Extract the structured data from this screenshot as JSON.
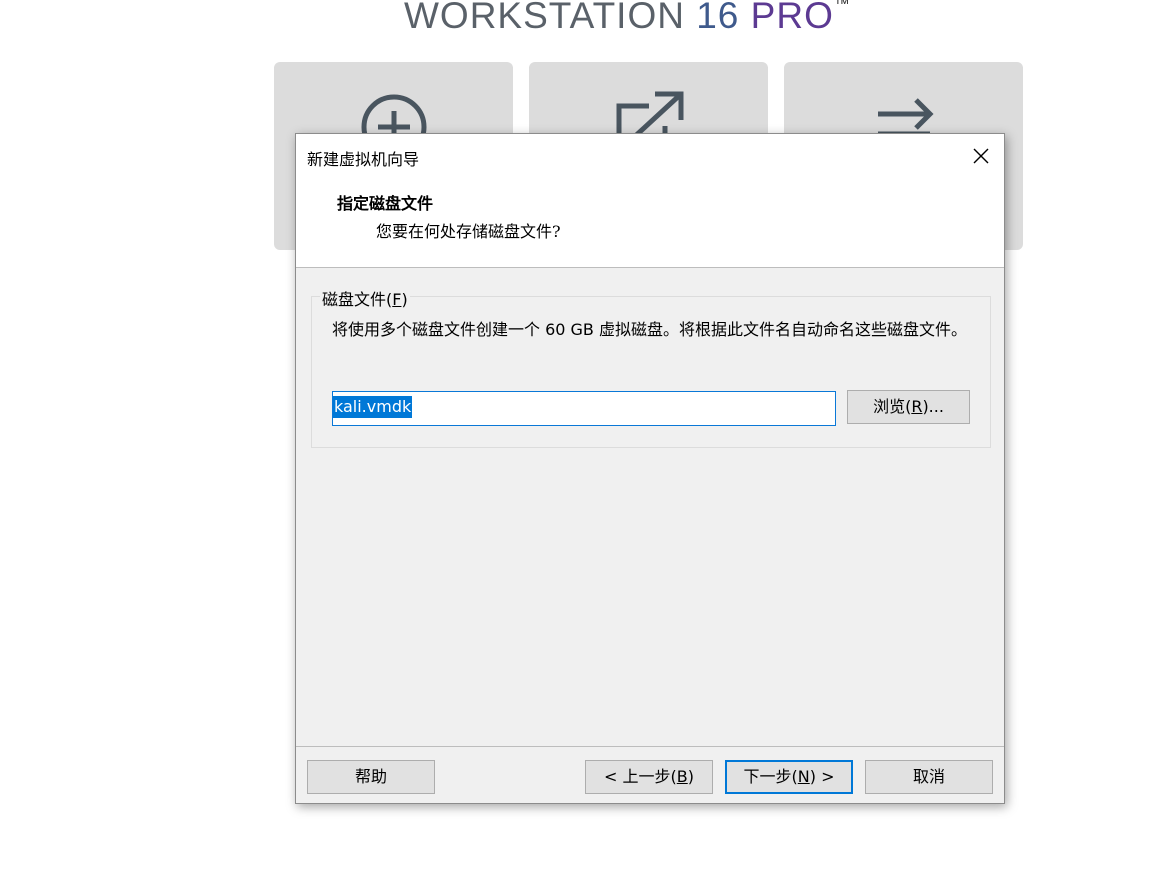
{
  "brand": {
    "prefix": "WORKSTATION",
    "version": "16",
    "edition": "PRO",
    "trademark": "™"
  },
  "home_tiles": [
    {
      "icon": "plus-circle-icon"
    },
    {
      "icon": "open-external-icon"
    },
    {
      "icon": "transfer-arrows-icon"
    }
  ],
  "dialog": {
    "title": "新建虚拟机向导",
    "heading": "指定磁盘文件",
    "subheading": "您要在何处存储磁盘文件?",
    "group": {
      "label_text": "磁盘文件(",
      "label_key": "F",
      "label_end": ")",
      "description": "将使用多个磁盘文件创建一个 60 GB 虚拟磁盘。将根据此文件名自动命名这些磁盘文件。",
      "file_value": "kali.vmdk",
      "browse": {
        "text": "浏览(",
        "key": "R",
        "end": ")..."
      }
    },
    "buttons": {
      "help": "帮助",
      "back": {
        "text": "< 上一步(",
        "key": "B",
        "end": ")"
      },
      "next": {
        "text": "下一步(",
        "key": "N",
        "end": ") >"
      },
      "cancel": "取消"
    }
  }
}
